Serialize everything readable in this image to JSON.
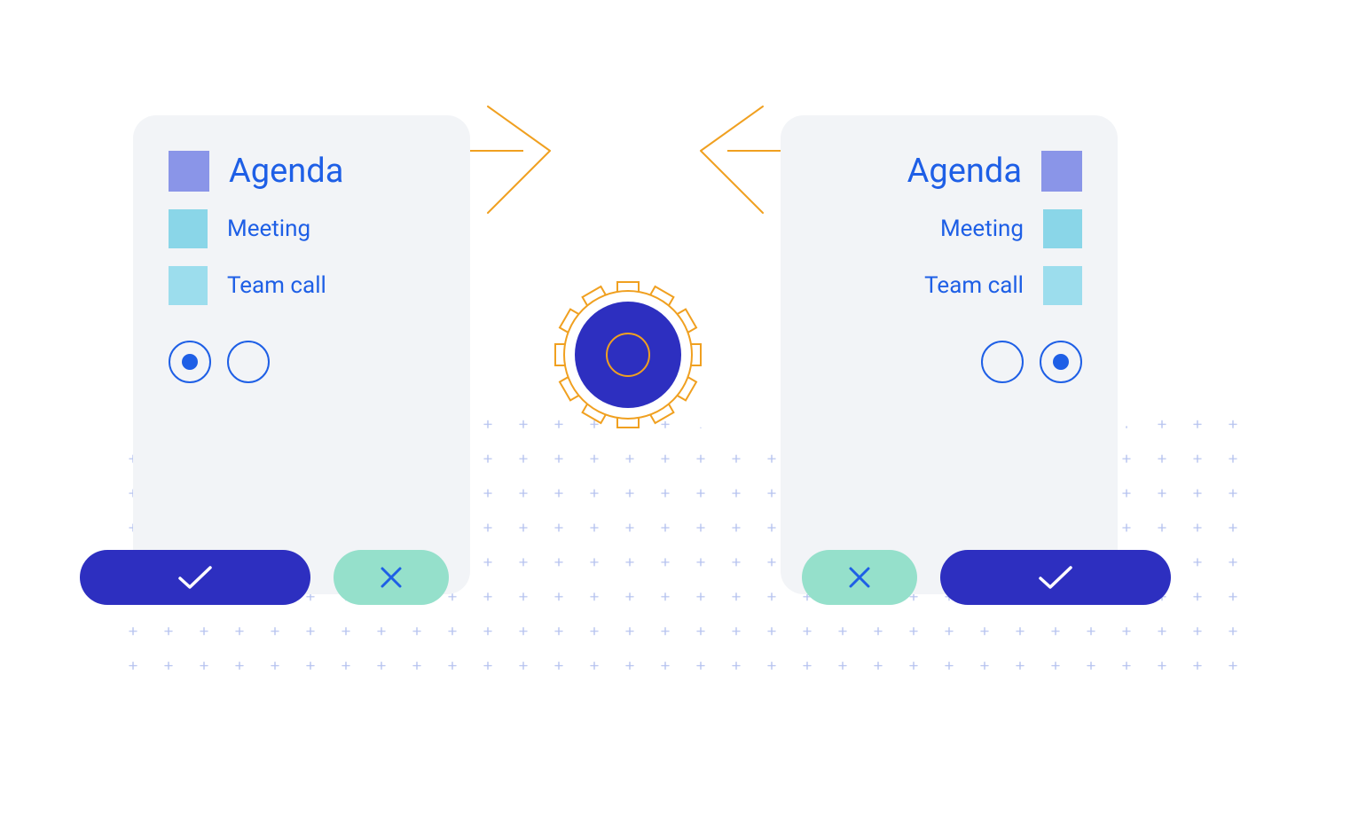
{
  "colors": {
    "blue_text": "#1e5fe6",
    "card_bg": "#f2f4f7",
    "primary_btn": "#2d2fc0",
    "secondary_btn": "#95e0cb",
    "amber": "#f0a020",
    "purple_sq": "#8a95e8",
    "cyan_sq": "#8ad6e8",
    "plus_grid": "#b6c3ef"
  },
  "left_card": {
    "title": "Agenda",
    "items": [
      "Meeting",
      "Team call"
    ],
    "radio_selected_index": 0
  },
  "right_card": {
    "title": "Agenda",
    "items": [
      "Meeting",
      "Team call"
    ],
    "radio_selected_index": 1
  },
  "icons": {
    "confirm": "check-icon",
    "cancel": "close-icon",
    "gear": "gear-icon",
    "arrow_right": "arrow-right-icon",
    "arrow_left": "arrow-left-icon"
  }
}
